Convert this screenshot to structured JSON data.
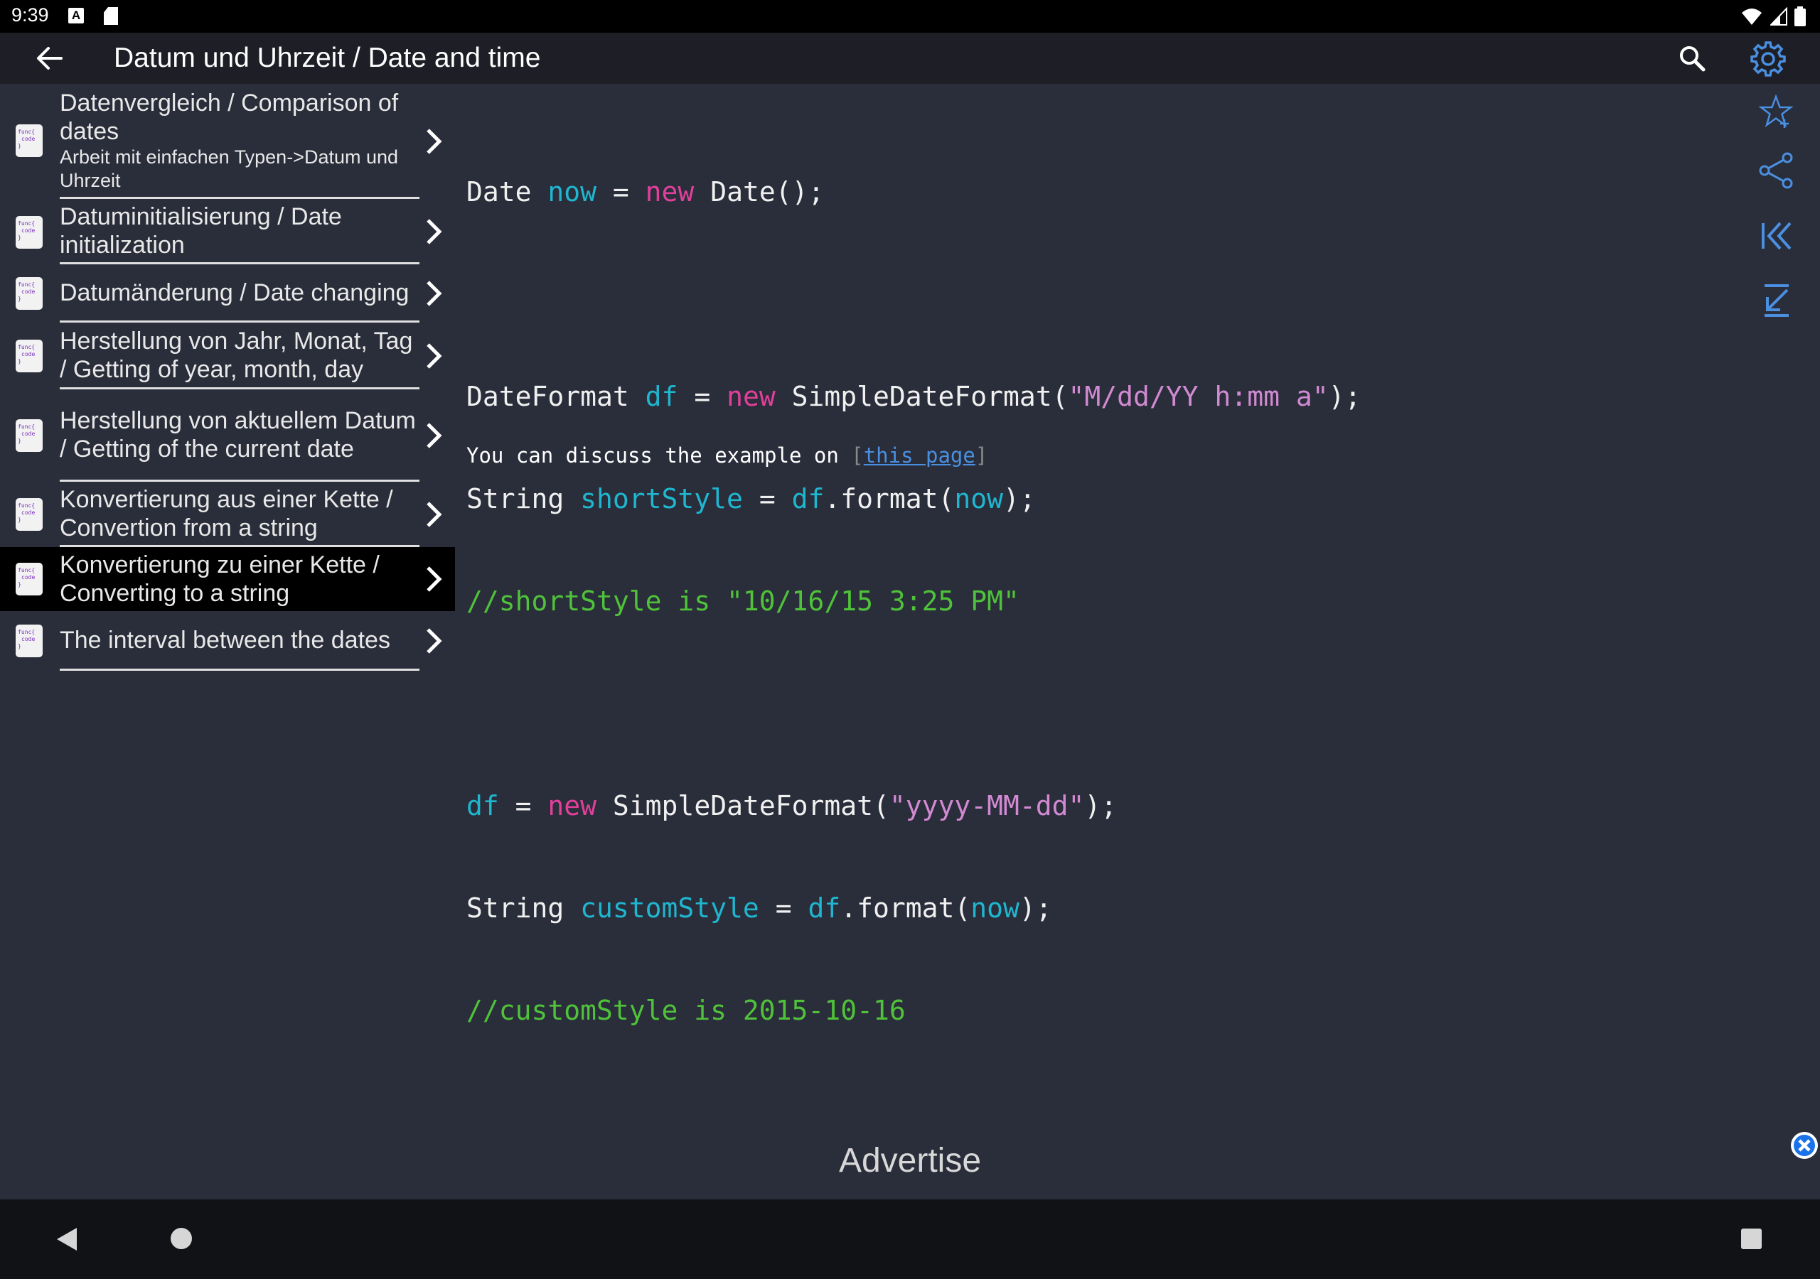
{
  "status_bar": {
    "time": "9:39",
    "a_badge": "A"
  },
  "app_bar": {
    "title": "Datum und Uhrzeit / Date and time"
  },
  "sidebar": {
    "items": [
      {
        "title": "Datenvergleich / Comparison of dates",
        "subtitle": "Arbeit mit einfachen Typen->Datum und Uhrzeit"
      },
      {
        "title": "Datuminitialisierung / Date initialization"
      },
      {
        "title": "Datumänderung / Date changing"
      },
      {
        "title": "Herstellung von Jahr, Monat, Tag / Getting of year, month, day"
      },
      {
        "title": "Herstellung von aktuellem Datum / Getting of the current date"
      },
      {
        "title": "Konvertierung aus einer Kette / Convertion from a string"
      },
      {
        "title": "Konvertierung zu einer Kette / Converting to a string"
      },
      {
        "title": "The interval between the dates"
      }
    ],
    "icon_lines": [
      "func{",
      "code",
      "}"
    ]
  },
  "code": {
    "l1": {
      "a": "Date ",
      "b": "now",
      "c": " = ",
      "d": "new",
      "e": " Date();"
    },
    "l3": {
      "a": "DateFormat ",
      "b": "df",
      "c": " = ",
      "d": "new",
      "e": " SimpleDateFormat(",
      "f": "\"M/dd/YY h:mm a\"",
      "g": ");"
    },
    "l4": {
      "a": "String ",
      "b": "shortStyle",
      "c": " = ",
      "d": "df",
      "e": ".format(",
      "f": "now",
      "g": ");"
    },
    "l5": "//shortStyle is \"10/16/15 3:25 PM\"",
    "l7": {
      "a": "df",
      "b": " = ",
      "c": "new",
      "d": " SimpleDateFormat(",
      "e": "\"yyyy-MM-dd\"",
      "f": ");"
    },
    "l8": {
      "a": "String ",
      "b": "customStyle",
      "c": " = ",
      "d": "df",
      "e": ".format(",
      "f": "now",
      "g": ");"
    },
    "l9": "//customStyle is 2015-10-16"
  },
  "discuss": {
    "text": "You can discuss the example on ",
    "open": "[",
    "link": "this page",
    "close": "]"
  },
  "advertise": "Advertise",
  "colors": {
    "background": "#2a2d3a",
    "appbar": "#1e1f26",
    "accent": "#4a8fe0",
    "keyword": "#e0409a",
    "variable": "#1fb6cf",
    "string": "#d18ad2",
    "comment": "#4fc23a"
  }
}
